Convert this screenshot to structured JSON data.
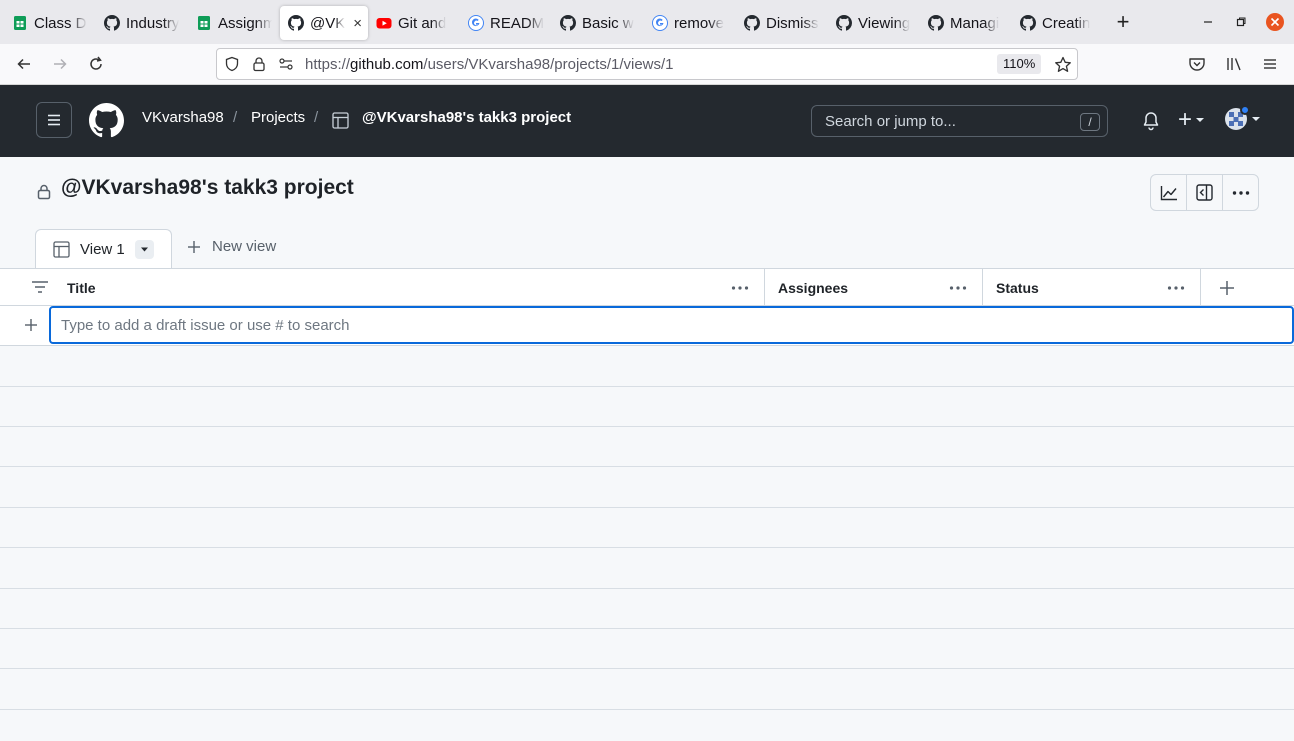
{
  "browser": {
    "tabs": [
      {
        "label": "Class D",
        "icon": "sheets-icon"
      },
      {
        "label": "Industry",
        "icon": "github-icon"
      },
      {
        "label": "Assignm",
        "icon": "sheets-icon"
      },
      {
        "label": "@VK",
        "icon": "github-icon",
        "active": true
      },
      {
        "label": "Git and",
        "icon": "youtube-icon"
      },
      {
        "label": "READM",
        "icon": "google-icon"
      },
      {
        "label": "Basic w",
        "icon": "github-icon"
      },
      {
        "label": "remove",
        "icon": "google-icon"
      },
      {
        "label": "Dismiss",
        "icon": "github-icon"
      },
      {
        "label": "Viewing",
        "icon": "github-icon"
      },
      {
        "label": "Managi",
        "icon": "github-icon"
      },
      {
        "label": "Creatin",
        "icon": "github-icon"
      }
    ],
    "close_tab_glyph": "×",
    "new_tab_glyph": "+",
    "url_prefix": "https://",
    "url_host": "github.com",
    "url_path": "/users/VKvarsha98/projects/1/views/1",
    "zoom": "110%"
  },
  "header": {
    "user": "VKvarsha98",
    "projects_link": "Projects",
    "separator": "/",
    "project_name": "@VKvarsha98's takk3 project",
    "search_placeholder": "Search or jump to...",
    "search_shortcut": "/",
    "plus_glyph": "+"
  },
  "project": {
    "title": "@VKvarsha98's takk3 project",
    "view_tab": "View 1",
    "new_view": "New view",
    "columns": [
      "Title",
      "Assignees",
      "Status"
    ],
    "draft_placeholder": "Type to add a draft issue or use # to search",
    "add_glyph": "+"
  },
  "colors": {
    "header_bg": "#24292f",
    "accent": "#0969da",
    "page_bg": "#f6f8fa",
    "notification_dot": "#2f81f7"
  }
}
